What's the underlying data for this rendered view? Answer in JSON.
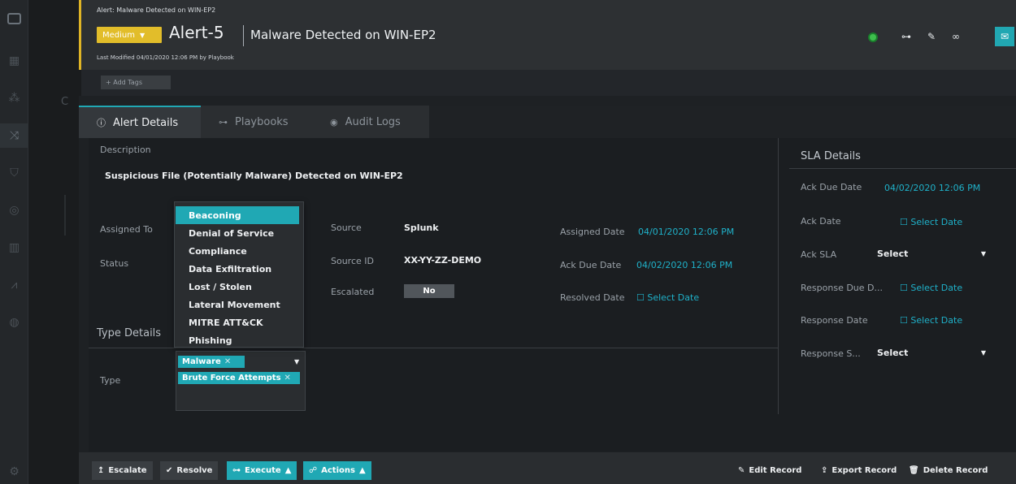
{
  "header": {
    "breadcrumb": "Alert: Malware Detected on WIN-EP2",
    "severity": "Medium",
    "alert_id": "Alert-5",
    "title": "Malware Detected on WIN-EP2",
    "last_modified": "Last Modified 04/01/2020 12:06 PM by Playbook"
  },
  "tags": {
    "add_label": "+ Add Tags"
  },
  "tabs": [
    {
      "label": "Alert Details",
      "icon": "info-icon"
    },
    {
      "label": "Playbooks",
      "icon": "playbook-icon"
    },
    {
      "label": "Audit Logs",
      "icon": "eye-icon"
    }
  ],
  "details": {
    "description_label": "Description",
    "description": "Suspicious File (Potentially Malware) Detected on WIN-EP2",
    "assigned_to_label": "Assigned To",
    "status_label": "Status",
    "source_label": "Source",
    "source": "Splunk",
    "source_id_label": "Source ID",
    "source_id": "XX-YY-ZZ-DEMO",
    "escalated_label": "Escalated",
    "escalated": "No",
    "assigned_date_label": "Assigned Date",
    "assigned_date": "04/01/2020 12:06 PM",
    "ack_due_label": "Ack Due Date",
    "ack_due": "04/02/2020 12:06 PM",
    "resolved_label": "Resolved Date",
    "select_date": "Select Date"
  },
  "type_section": {
    "heading": "Type Details",
    "type_label": "Type",
    "selected": [
      "Malware",
      "Brute Force Attempts"
    ],
    "options": [
      "Beaconing",
      "Denial of Service",
      "Compliance",
      "Data Exfiltration",
      "Lost / Stolen",
      "Lateral Movement",
      "MITRE ATT&CK",
      "Phishing"
    ]
  },
  "sla": {
    "heading": "SLA Details",
    "ack_due_label": "Ack Due Date",
    "ack_due": "04/02/2020 12:06 PM",
    "ack_date_label": "Ack Date",
    "ack_sla_label": "Ack SLA",
    "response_due_label": "Response Due D...",
    "response_date_label": "Response Date",
    "response_sla_label": "Response S...",
    "select_date": "Select Date",
    "select": "Select"
  },
  "footer": {
    "escalate": "Escalate",
    "resolve": "Resolve",
    "execute": "Execute",
    "actions": "Actions",
    "edit": "Edit Record",
    "export": "Export Record",
    "delete": "Delete Record"
  },
  "colors": {
    "accent": "#20a8b4",
    "severity": "#e2bd2a",
    "link": "#1fb1c9"
  }
}
